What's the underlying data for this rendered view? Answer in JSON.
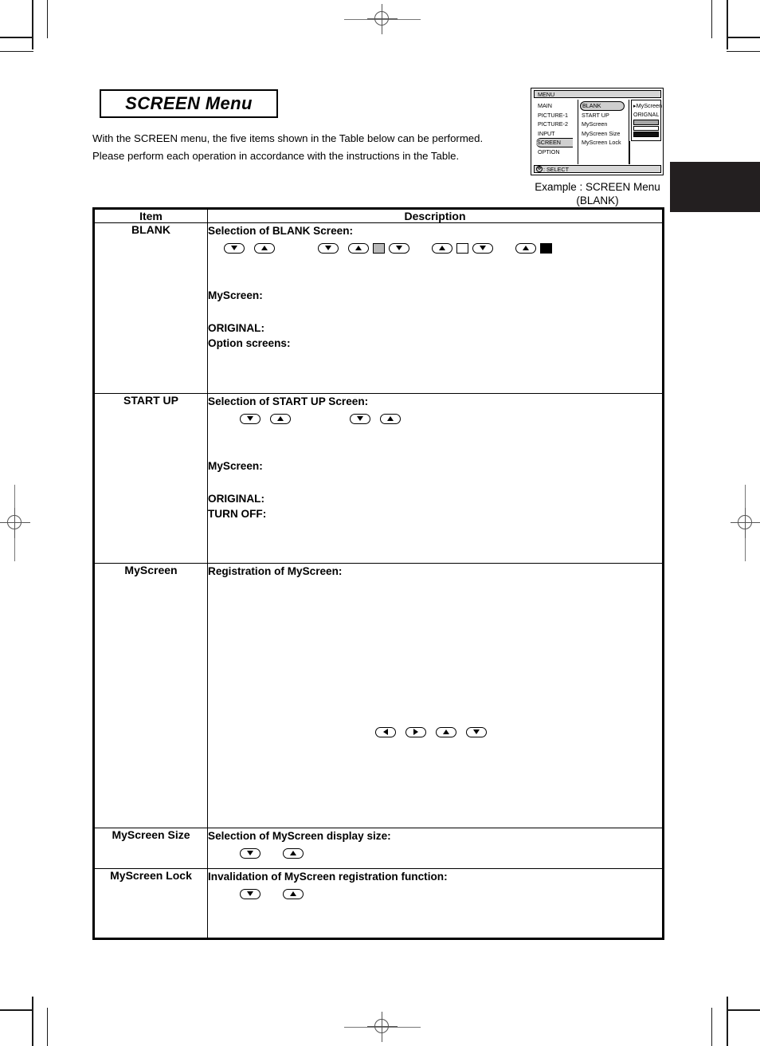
{
  "page": {
    "title": "SCREEN Menu",
    "intro_line1": "With the SCREEN menu, the five items shown in the Table below can be performed.",
    "intro_line2": "Please perform each operation in accordance with the instructions in the Table."
  },
  "osd": {
    "menu_label": "MENU",
    "select_label": ": SELECT",
    "cursor_icon": "four-way-cursor-icon",
    "left_items": [
      "MAIN",
      "PICTURE-1",
      "PICTURE-2",
      "INPUT",
      "SCREEN",
      "OPTION"
    ],
    "left_selected": "SCREEN",
    "mid_items": [
      "BLANK",
      "START UP",
      "MyScreen",
      "MyScreen Size",
      "MyScreen Lock"
    ],
    "mid_selected": "BLANK",
    "right_items": [
      "▸MyScreen",
      "ORIGNAL"
    ],
    "right_swatches": [
      "#a6a6a6",
      "#ffffff",
      "#111111"
    ],
    "caption_line1": "Example : SCREEN Menu",
    "caption_line2": "(BLANK)"
  },
  "table": {
    "headers": {
      "item": "Item",
      "description": "Description"
    },
    "rows": [
      {
        "item": "BLANK",
        "heading": "Selection of BLANK Screen:",
        "keys": [
          "down",
          "up",
          "gap-l",
          "down",
          "up",
          "square-gray",
          "down",
          "up",
          "square-white",
          "down",
          "up",
          "square-black"
        ],
        "subheads": [
          "MyScreen:",
          "ORIGINAL:",
          "Option screens:"
        ]
      },
      {
        "item": "START UP",
        "heading": "Selection of START UP Screen:",
        "keys": [
          "down",
          "up",
          "gap-l",
          "down",
          "up"
        ],
        "subheads": [
          "MyScreen:",
          "ORIGINAL:",
          "TURN OFF:"
        ]
      },
      {
        "item": "MyScreen",
        "heading": "Registration of MyScreen:",
        "keys": [
          "left",
          "right",
          "up",
          "down"
        ],
        "subheads": []
      },
      {
        "item": "MyScreen Size",
        "heading": "Selection of MyScreen display size:",
        "keys": [
          "down",
          "up"
        ],
        "subheads": []
      },
      {
        "item": "MyScreen Lock",
        "heading": "Invalidation of MyScreen registration function:",
        "keys": [
          "down",
          "up"
        ],
        "subheads": []
      }
    ]
  }
}
